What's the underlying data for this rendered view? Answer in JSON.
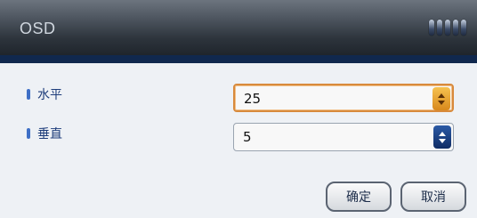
{
  "window": {
    "title": "OSD"
  },
  "rows": [
    {
      "label": "水平",
      "value": "25",
      "active": true
    },
    {
      "label": "垂直",
      "value": "5",
      "active": false
    }
  ],
  "buttons": {
    "ok": "确定",
    "cancel": "取消"
  },
  "colors": {
    "accent_active": "#d88a3c",
    "spinner_blue": "#1a3f80",
    "title_bar": "#2d343c"
  }
}
